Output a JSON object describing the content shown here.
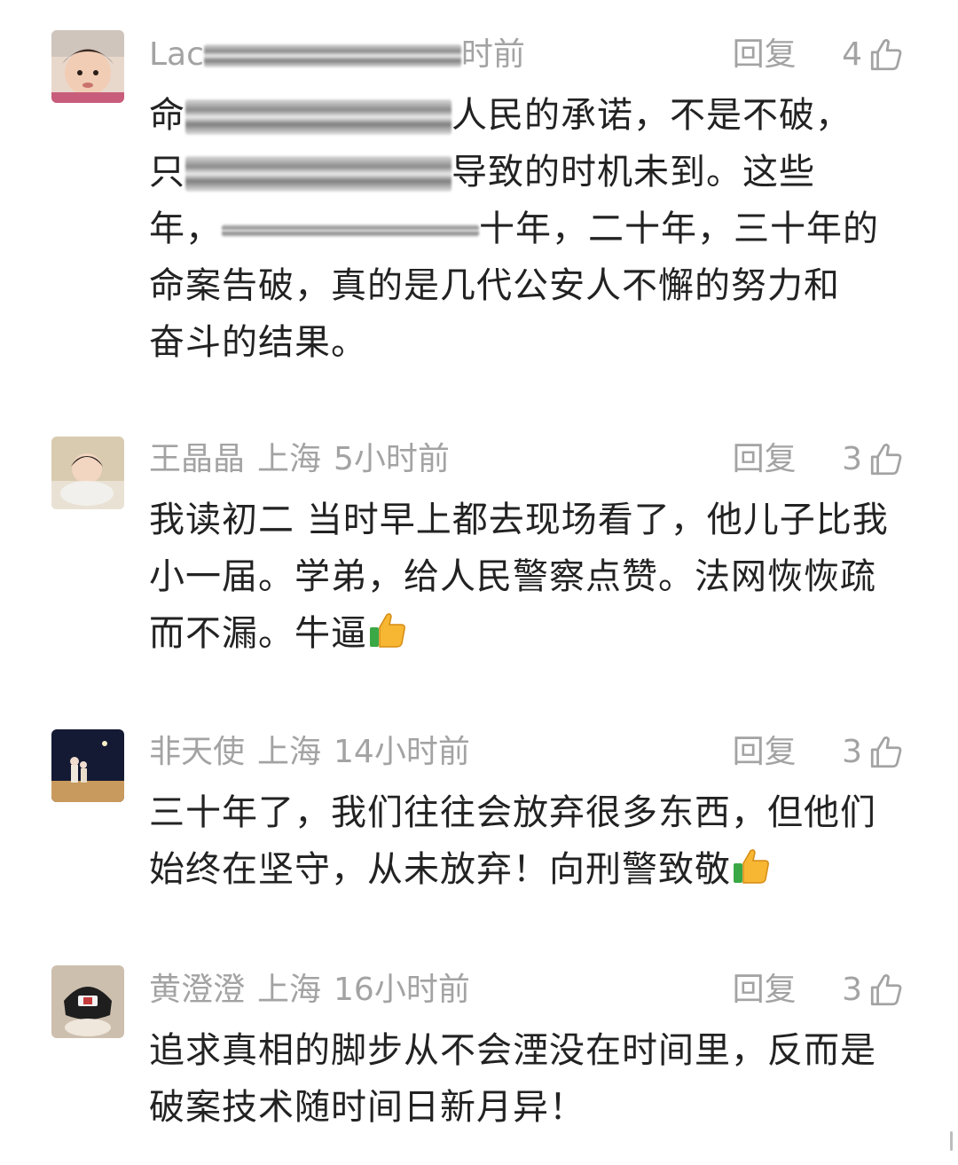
{
  "comments": [
    {
      "user": "Lac",
      "location": "",
      "time": "时前",
      "reply_label": "回复",
      "likes": "4",
      "lines": [
        {
          "pre": "命",
          "post": "人民的承诺，不是不破，"
        },
        {
          "pre": "只",
          "post": "导致的时机未到。这些"
        },
        {
          "pre": "年，",
          "post": "十年，二十年，三十年的"
        },
        {
          "pre": "命案告破，真的是几代公安人不懈的努力和",
          "post": ""
        },
        {
          "pre": "奋斗的结果。",
          "post": ""
        }
      ]
    },
    {
      "user": "王晶晶",
      "location": "上海",
      "time": "5小时前",
      "reply_label": "回复",
      "likes": "3",
      "text1": "我读初二 当时早上都去现场看了，他儿子比我小一届。学弟，给人民警察点赞。法网恢恢疏而不漏。牛逼"
    },
    {
      "user": "非天使",
      "location": "上海",
      "time": "14小时前",
      "reply_label": "回复",
      "likes": "3",
      "text1": "三十年了，我们往往会放弃很多东西，但他们始终在坚守，从未放弃！向刑警致敬"
    },
    {
      "user": "黄澄澄",
      "location": "上海",
      "time": "16小时前",
      "reply_label": "回复",
      "likes": "3",
      "text1": "追求真相的脚步从不会湮没在时间里，反而是破案技术随时间日新月异！"
    }
  ],
  "icons": {
    "like": "thumbs-up-outline-icon",
    "emoji": "thumbs-up-emoji-icon"
  },
  "colors": {
    "meta": "#a3a3a3",
    "text": "#222222",
    "background": "#ffffff"
  }
}
